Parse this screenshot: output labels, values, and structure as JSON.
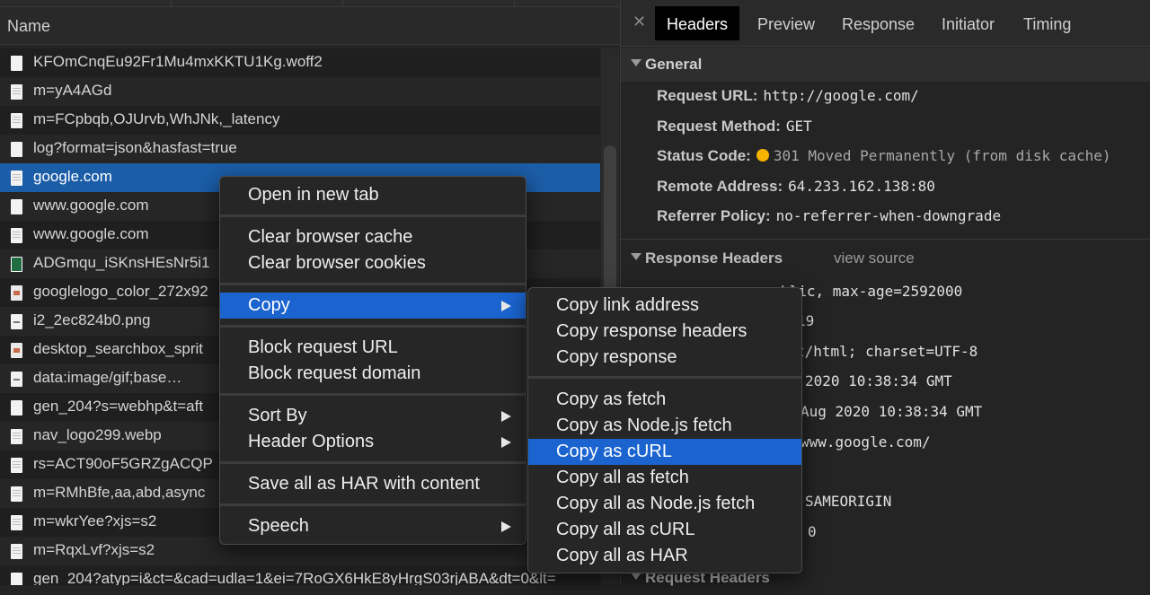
{
  "network": {
    "column_name": "Name",
    "rows": [
      {
        "name": "KFOmCnqEu92Fr1Mu4mxKKTU1Kg.woff2",
        "icon": "blank-file-icon"
      },
      {
        "name": "m=yA4AGd",
        "icon": "document-icon"
      },
      {
        "name": "m=FCpbqb,OJUrvb,WhJNk,_latency",
        "icon": "document-icon"
      },
      {
        "name": "log?format=json&hasfast=true",
        "icon": "blank-file-icon"
      },
      {
        "name": "google.com",
        "icon": "document-icon",
        "selected": true
      },
      {
        "name": "www.google.com",
        "icon": "blank-file-icon"
      },
      {
        "name": "www.google.com",
        "icon": "document-icon"
      },
      {
        "name": "ADGmqu_iSKnsHEsNr5i1",
        "icon": "image-icon"
      },
      {
        "name": "googlelogo_color_272x92",
        "icon": "image-icon"
      },
      {
        "name": "i2_2ec824b0.png",
        "icon": "image-icon"
      },
      {
        "name": "desktop_searchbox_sprit",
        "icon": "image-icon"
      },
      {
        "name": "data:image/gif;base…",
        "icon": "image-icon"
      },
      {
        "name": "gen_204?s=webhp&t=aft",
        "icon": "blank-file-icon"
      },
      {
        "name": "nav_logo299.webp",
        "icon": "document-icon"
      },
      {
        "name": "rs=ACT90oF5GRZgACQP",
        "icon": "document-icon"
      },
      {
        "name": "m=RMhBfe,aa,abd,async",
        "icon": "document-icon"
      },
      {
        "name": "m=wkrYee?xjs=s2",
        "icon": "document-icon"
      },
      {
        "name": "m=RqxLvf?xjs=s2",
        "icon": "document-icon"
      },
      {
        "name": "gen_204?atyp=i&ct=&cad=udla=1&ei=7RoGX6HkE8yHrgS03rjABA&dt=0&lt=",
        "icon": "blank-file-icon"
      }
    ]
  },
  "detail": {
    "tabs": [
      "Headers",
      "Preview",
      "Response",
      "Initiator",
      "Timing"
    ],
    "active_tab": "Headers",
    "general": {
      "title": "General",
      "request_url_label": "Request URL:",
      "request_url": "http://google.com/",
      "request_method_label": "Request Method:",
      "request_method": "GET",
      "status_code_label": "Status Code:",
      "status_code": "301 Moved Permanently (from disk cache)",
      "remote_address_label": "Remote Address:",
      "remote_address": "64.233.162.138:80",
      "referrer_policy_label": "Referrer Policy:",
      "referrer_policy": "no-referrer-when-downgrade"
    },
    "response_headers": {
      "title": "Response Headers",
      "view_source": "view source",
      "visible_fragments": [
        "blic, max-age=2592000",
        "19",
        "t/html; charset=UTF-8",
        " 2020 10:38:34 GMT",
        "Aug 2020 10:38:34 GMT",
        "www.google.com/",
        "SAMEORIGIN",
        "0"
      ]
    },
    "request_headers_title": "Request Headers"
  },
  "context_menu": {
    "open_new_tab": "Open in new tab",
    "clear_cache": "Clear browser cache",
    "clear_cookies": "Clear browser cookies",
    "copy": "Copy",
    "block_url": "Block request URL",
    "block_domain": "Block request domain",
    "sort_by": "Sort By",
    "header_options": "Header Options",
    "save_har": "Save all as HAR with content",
    "speech": "Speech"
  },
  "copy_submenu": {
    "copy_link": "Copy link address",
    "copy_resp_headers": "Copy response headers",
    "copy_response": "Copy response",
    "copy_fetch": "Copy as fetch",
    "copy_node_fetch": "Copy as Node.js fetch",
    "copy_curl": "Copy as cURL",
    "copy_all_fetch": "Copy all as fetch",
    "copy_all_node": "Copy all as Node.js fetch",
    "copy_all_curl": "Copy all as cURL",
    "copy_all_har": "Copy all as HAR"
  },
  "colors": {
    "selection": "#1b5da7",
    "menu_highlight": "#1b64cf",
    "status_dot": "#f5b400"
  }
}
